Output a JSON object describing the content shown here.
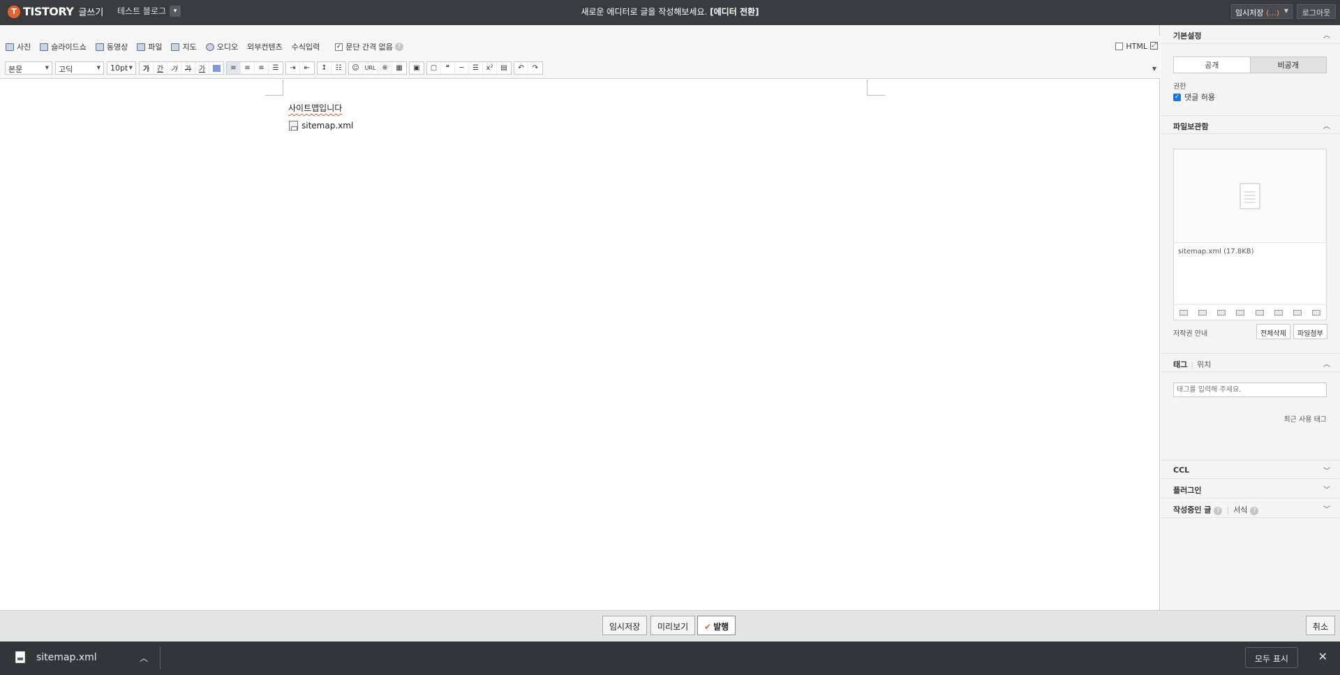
{
  "topbar": {
    "logo_mark": "T",
    "logo_text": "TISTORY",
    "mode": "글쓰기",
    "blog_name": "테스트 블로그",
    "notice": "새로운 에디터로 글을 작성해보세요.",
    "notice_link": "[에디터 전환]",
    "save_label": "임시저장",
    "save_count": "(...)",
    "logout": "로그아웃"
  },
  "editor": {
    "title_value": "사이트맵입니다",
    "attach_buttons": [
      "사진",
      "슬라이드쇼",
      "동영상",
      "파일",
      "지도",
      "오디오",
      "외부컨텐츠",
      "수식입력"
    ],
    "paragraph_option": "문단 간격 없음",
    "html_toggle": "HTML",
    "format": {
      "style": "본문",
      "font": "고딕",
      "size": "10pt",
      "text_buttons": [
        "가",
        "간",
        "가",
        "가",
        "가"
      ],
      "url_label": "URL"
    },
    "content": {
      "line1": "사이트맵입니다",
      "file_name": "sitemap.xml"
    }
  },
  "sidebar": {
    "basic_settings": "기본설정",
    "visibility": {
      "public": "공개",
      "private": "비공개",
      "selected": "비공개"
    },
    "permission_label": "권한",
    "allow_comments": "댓글 허용",
    "file_storage": "파일보관함",
    "file_entry": "sitemap.xml (17.8KB)",
    "copyright": "저작권 안내",
    "delete_all": "전체삭제",
    "attach_file": "파일첨부",
    "tag": "태그",
    "location": "위치",
    "tag_placeholder": "태그를 입력해 주세요.",
    "recent_tags": "최근 사용 태그",
    "ccl": "CCL",
    "plugin": "플러그인",
    "writing": "작성중인 글",
    "format": "서식"
  },
  "actions": {
    "save": "임시저장",
    "preview": "미리보기",
    "publish": "발행",
    "cancel": "취소"
  },
  "download_bar": {
    "file": "sitemap.xml",
    "show_all": "모두 표시"
  }
}
